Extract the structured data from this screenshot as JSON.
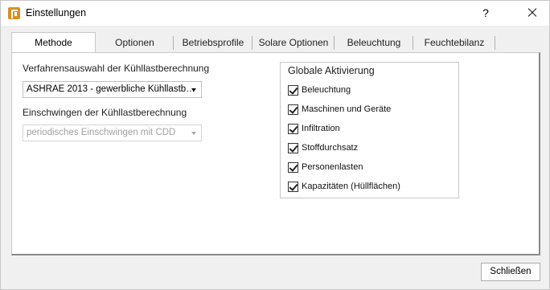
{
  "window": {
    "title": "Einstellungen",
    "help_label": "?",
    "app_icon": "app-logo-icon",
    "close_icon": "close-icon"
  },
  "tabs": [
    {
      "label": "Methode",
      "active": true
    },
    {
      "label": "Optionen",
      "active": false
    },
    {
      "label": "Betriebsprofile",
      "active": false
    },
    {
      "label": "Solare Optionen",
      "active": false
    },
    {
      "label": "Beleuchtung",
      "active": false
    },
    {
      "label": "Feuchtebilanz",
      "active": false
    }
  ],
  "method": {
    "procedure_label": "Verfahrensauswahl der Kühllastberechnung",
    "procedure_value": "ASHRAE 2013 - gewerbliche Kühllastb…",
    "transient_label": "Einschwingen der Kühllastberechnung",
    "transient_value": "periodisches Einschwingen mit CDD"
  },
  "global_activation": {
    "title": "Globale Aktivierung",
    "items": [
      {
        "label": "Beleuchtung",
        "checked": true
      },
      {
        "label": "Maschinen und Geräte",
        "checked": true
      },
      {
        "label": "Infiltration",
        "checked": true
      },
      {
        "label": "Stoffdurchsatz",
        "checked": true
      },
      {
        "label": "Personenlasten",
        "checked": true
      },
      {
        "label": "Kapazitäten (Hüllflächen)",
        "checked": true
      }
    ]
  },
  "footer": {
    "close_label": "Schließen"
  }
}
